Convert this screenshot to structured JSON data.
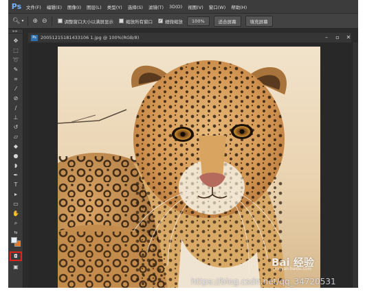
{
  "app": {
    "logo": "Ps",
    "menu": [
      "文件(F)",
      "编辑(E)",
      "图像(I)",
      "图层(L)",
      "类型(Y)",
      "选择(S)",
      "滤镜(T)",
      "3D(D)",
      "视图(V)",
      "窗口(W)",
      "帮助(H)"
    ]
  },
  "options": {
    "tool_icon": "zoom-icon",
    "checkboxes": [
      {
        "label": "调整窗口大小以满屏显示",
        "checked": false
      },
      {
        "label": "缩放所有窗口",
        "checked": false
      },
      {
        "label": "细微缩放",
        "checked": true
      }
    ],
    "buttons": [
      "100%",
      "适合屏幕",
      "填充屏幕"
    ]
  },
  "document": {
    "title": "20051215181433106 1.jpg @ 100%(RGB/8)",
    "icon": "Ps"
  },
  "tools": {
    "quick_mask_icon": "quick-mask-icon",
    "foreground_color": "#e8f0f7",
    "background_color": "#e27a2a"
  },
  "watermark": {
    "brand": "Bai 经验",
    "brand_sub": "jingyan.baidu.com",
    "url": "https://blog.csdn.net/qq_34720531"
  }
}
